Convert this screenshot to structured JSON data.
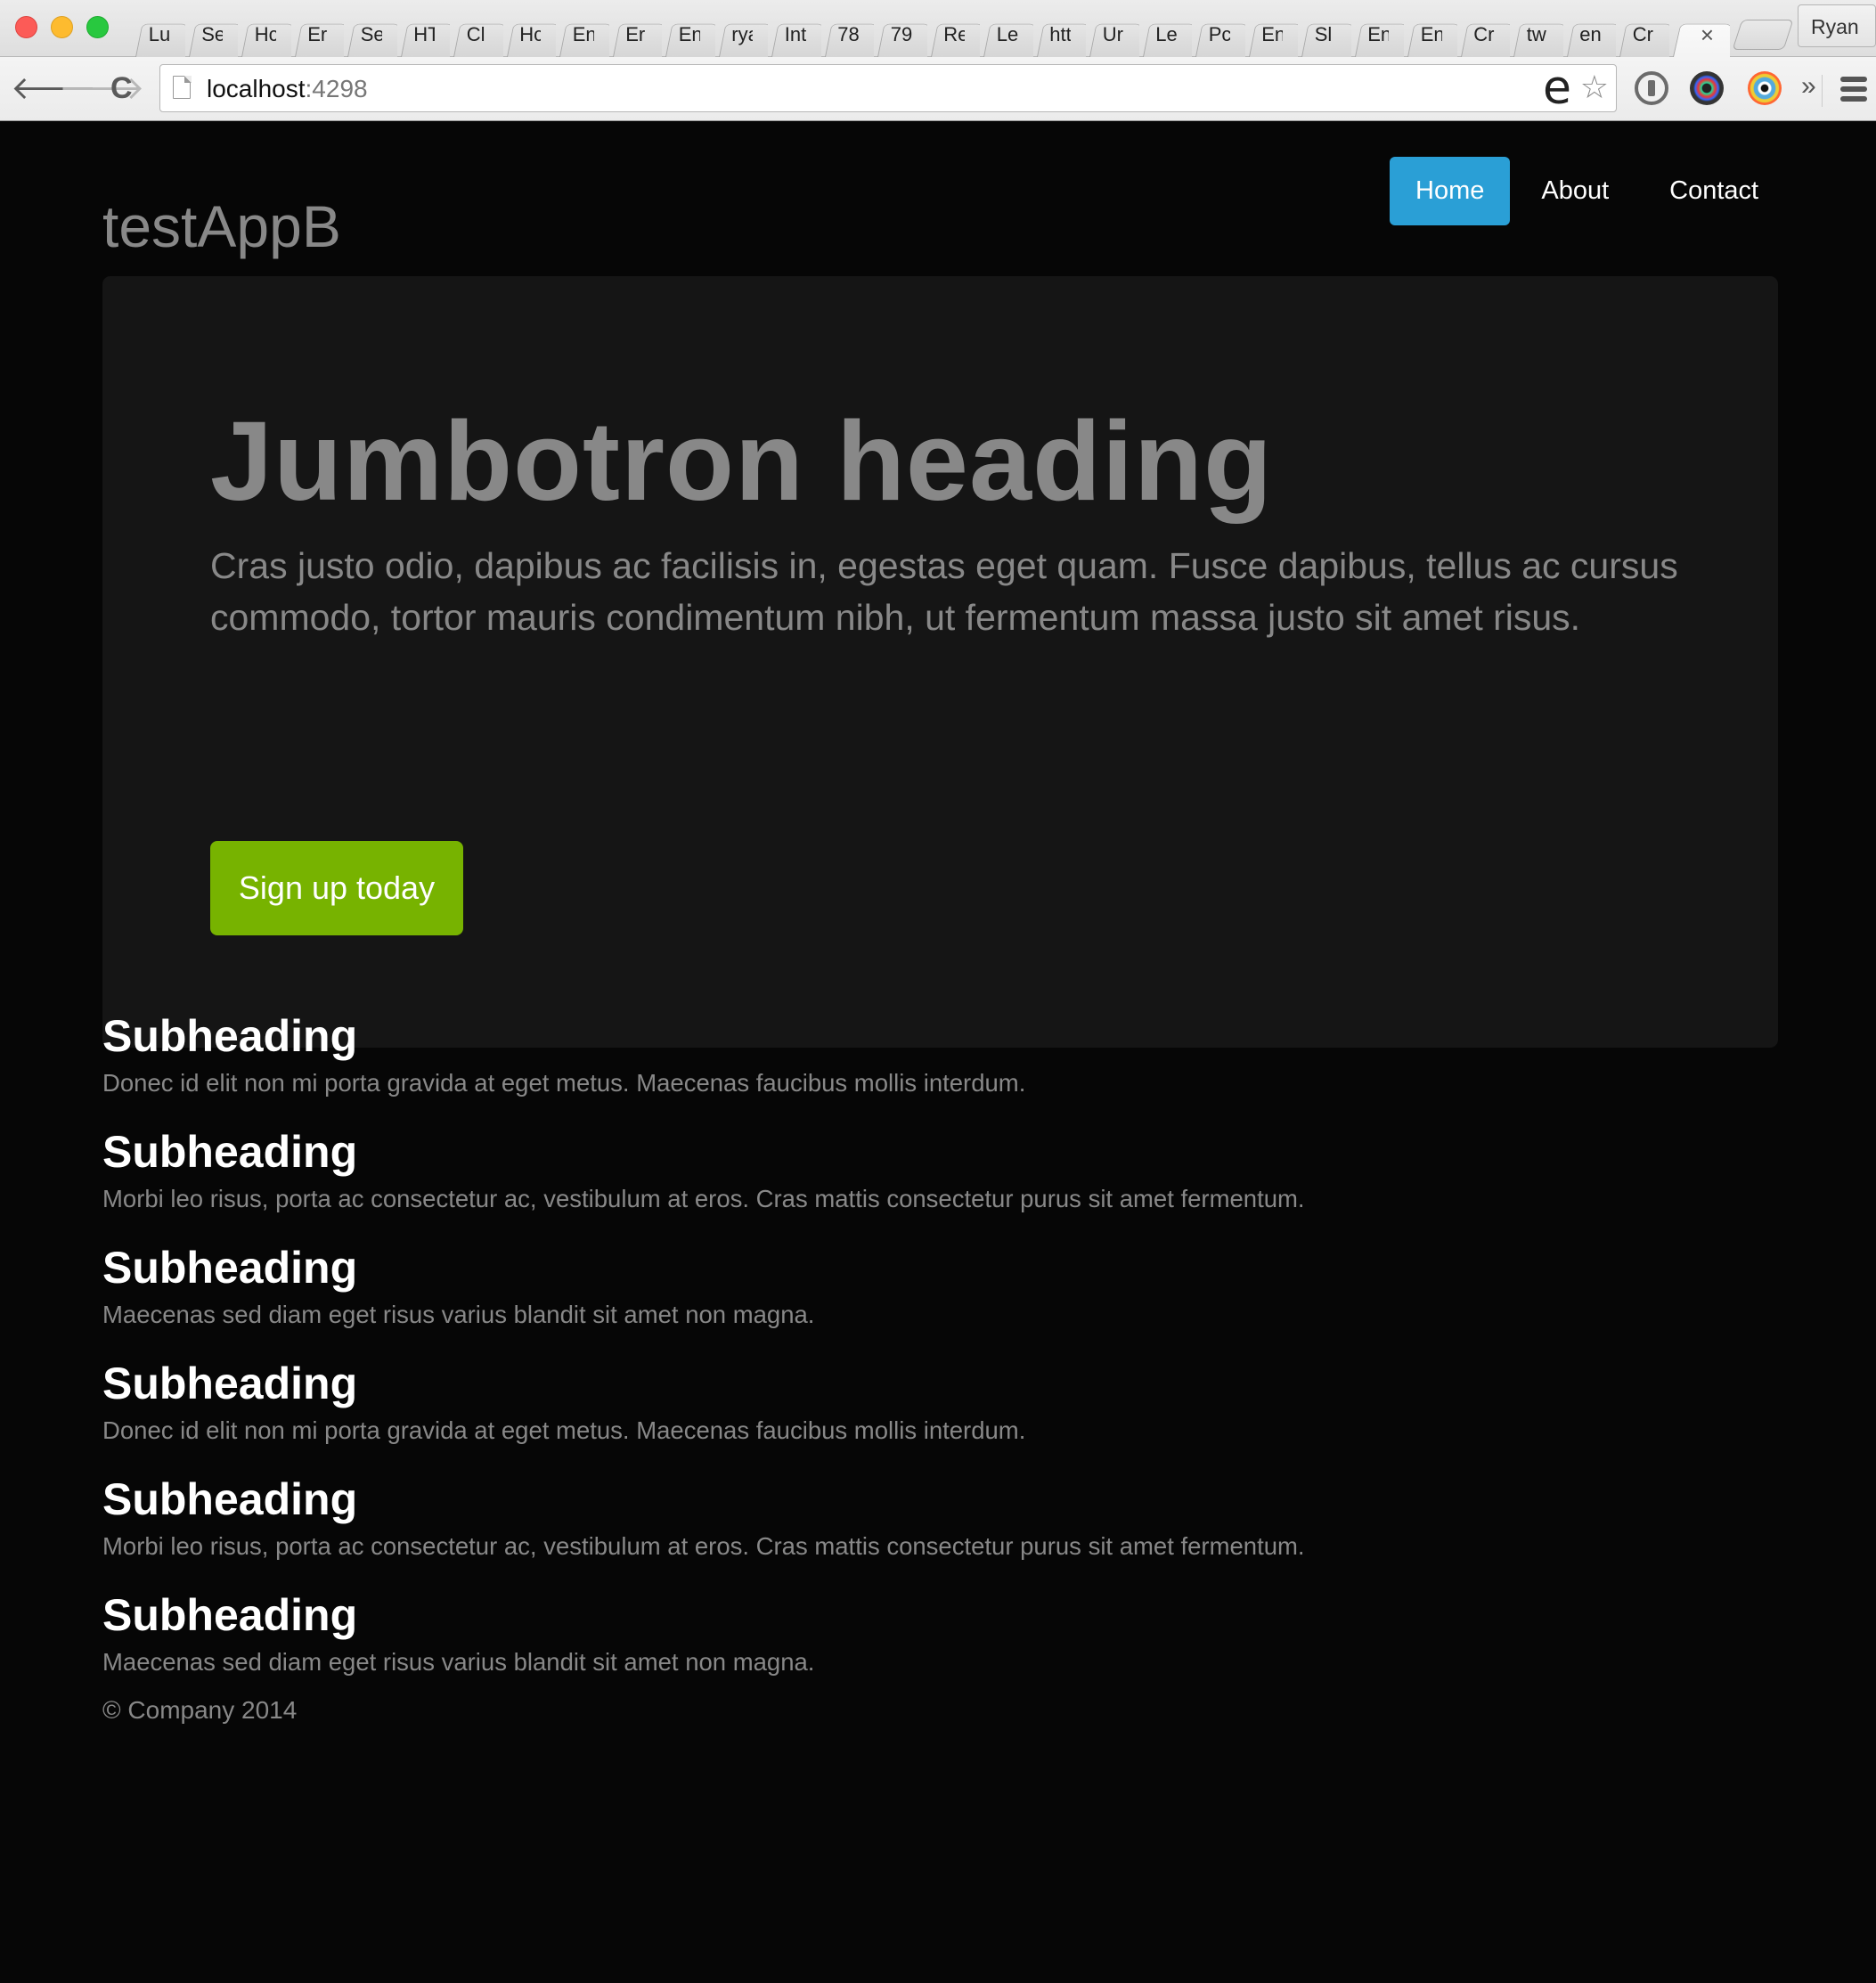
{
  "browser": {
    "tabs": [
      "Lu",
      "Se",
      "Hc",
      "Er",
      "Se",
      "HT",
      "Cl",
      "Hc",
      "En",
      "Er",
      "En",
      "rya",
      "Int",
      "78",
      "79",
      "Re",
      "Le",
      "htt",
      "Ur",
      "Le",
      "Pc",
      "En",
      "Sl",
      "En",
      "En",
      "Cr",
      "tw",
      "en",
      "Cr"
    ],
    "active_tab_close": "×",
    "profile_name": "Ryan",
    "url_host": "localhost",
    "url_port": ":4298",
    "omnibox_e": "e",
    "star": "☆",
    "back": "🡐",
    "forward": "🡒",
    "reload": "C",
    "overflow": "»"
  },
  "site": {
    "brand": "testAppB",
    "nav": [
      {
        "label": "Home",
        "active": true
      },
      {
        "label": "About",
        "active": false
      },
      {
        "label": "Contact",
        "active": false
      }
    ],
    "accent_color": "#2a9fd6",
    "success_color": "#77b300"
  },
  "jumbotron": {
    "heading": "Jumbotron heading",
    "lead": "Cras justo odio, dapibus ac facilisis in, egestas eget quam. Fusce dapibus, tellus ac cursus commodo, tortor mauris condimentum nibh, ut fermentum massa justo sit amet risus.",
    "button": "Sign up today"
  },
  "sections": [
    {
      "heading": "Subheading",
      "text": "Donec id elit non mi porta gravida at eget metus. Maecenas faucibus mollis interdum."
    },
    {
      "heading": "Subheading",
      "text": "Morbi leo risus, porta ac consectetur ac, vestibulum at eros. Cras mattis consectetur purus sit amet fermentum."
    },
    {
      "heading": "Subheading",
      "text": "Maecenas sed diam eget risus varius blandit sit amet non magna."
    },
    {
      "heading": "Subheading",
      "text": "Donec id elit non mi porta gravida at eget metus. Maecenas faucibus mollis interdum."
    },
    {
      "heading": "Subheading",
      "text": "Morbi leo risus, porta ac consectetur ac, vestibulum at eros. Cras mattis consectetur purus sit amet fermentum."
    },
    {
      "heading": "Subheading",
      "text": "Maecenas sed diam eget risus varius blandit sit amet non magna."
    }
  ],
  "footer": "© Company 2014"
}
